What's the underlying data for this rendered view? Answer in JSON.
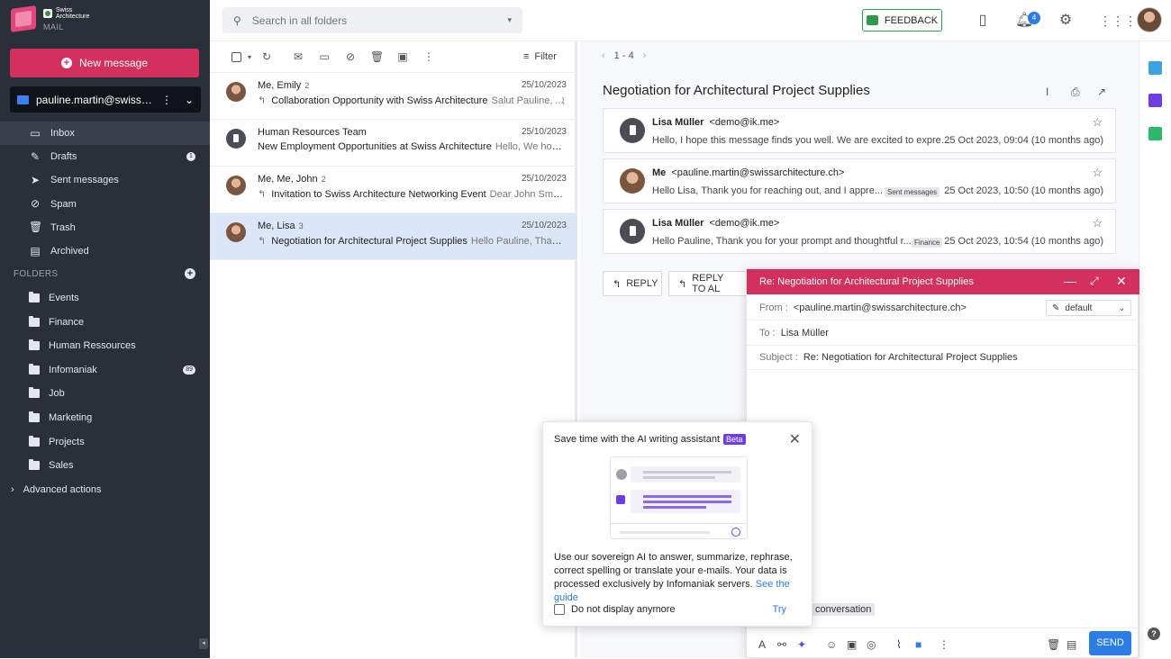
{
  "app": {
    "brand_line1": "Swiss",
    "brand_line2": "Architecture",
    "product": "MAIL"
  },
  "sidebar": {
    "new_message": "New message",
    "account": "pauline.martin@swissarchi...",
    "items": [
      {
        "label": "Inbox",
        "icon": "inbox-icon",
        "badge": ""
      },
      {
        "label": "Drafts",
        "icon": "drafts-icon",
        "badge": "1"
      },
      {
        "label": "Sent messages",
        "icon": "send-icon",
        "badge": ""
      },
      {
        "label": "Spam",
        "icon": "spam-icon",
        "badge": ""
      },
      {
        "label": "Trash",
        "icon": "trash-icon",
        "badge": ""
      },
      {
        "label": "Archived",
        "icon": "archive-icon",
        "badge": ""
      }
    ],
    "folders_title": "FOLDERS",
    "folders": [
      {
        "label": "Events",
        "badge": ""
      },
      {
        "label": "Finance",
        "badge": ""
      },
      {
        "label": "Human Ressources",
        "badge": ""
      },
      {
        "label": "Infomaniak",
        "badge": "89"
      },
      {
        "label": "Job",
        "badge": ""
      },
      {
        "label": "Marketing",
        "badge": ""
      },
      {
        "label": "Projects",
        "badge": ""
      },
      {
        "label": "Sales",
        "badge": ""
      }
    ],
    "advanced": "Advanced actions"
  },
  "topbar": {
    "search_placeholder": "Search in all folders",
    "feedback": "FEEDBACK",
    "notifications": "4"
  },
  "list": {
    "filter": "Filter",
    "rows": [
      {
        "from": "Me, Emily",
        "count": "2",
        "date": "25/10/2023",
        "subject": "Collaboration Opportunity with Swiss Architecture",
        "preview": "Salut Pauline, ...",
        "reply": true,
        "attach": true,
        "selected": false,
        "robot": false
      },
      {
        "from": "Human Resources Team",
        "count": "",
        "date": "25/10/2023",
        "subject": "New Employment Opportunities at Swiss Architecture",
        "preview": "Hello, We hope ...",
        "reply": false,
        "attach": false,
        "selected": false,
        "robot": true
      },
      {
        "from": "Me, Me, John",
        "count": "2",
        "date": "25/10/2023",
        "subject": "Invitation to Swiss Architecture Networking Event",
        "preview": "Dear John Smith,...",
        "reply": true,
        "attach": false,
        "selected": false,
        "robot": false
      },
      {
        "from": "Me, Lisa",
        "count": "3",
        "date": "25/10/2023",
        "subject": "Negotiation for Architectural Project Supplies",
        "preview": "Hello Pauline, Thank ...",
        "reply": true,
        "attach": false,
        "selected": true,
        "robot": false
      }
    ]
  },
  "reader": {
    "pager": "1 - 4",
    "title": "Negotiation for Architectural Project Supplies",
    "messages": [
      {
        "sender": "Lisa Müller",
        "email": "<demo@ik.me>",
        "preview": "Hello, I hope this message finds you well. We are excited to expre...",
        "tag": "",
        "date": "25 Oct 2023, 09:04 (10 months ago)",
        "robot": true
      },
      {
        "sender": "Me",
        "email": "<pauline.martin@swissarchitecture.ch>",
        "preview": "Hello Lisa, Thank you for reaching out, and I appre...",
        "tag": "Sent messages",
        "date": "25 Oct 2023, 10:50 (10 months ago)",
        "robot": false
      },
      {
        "sender": "Lisa Müller",
        "email": "<demo@ik.me>",
        "preview": "Hello Pauline, Thank you for your prompt and thoughtful r...",
        "tag": "Finance",
        "date": "25 Oct 2023, 10:54 (10 months ago)",
        "robot": true
      }
    ],
    "reply": "REPLY",
    "reply_all": "REPLY TO AL"
  },
  "compose": {
    "title": "Re: Negotiation for Architectural Project Supplies",
    "from_label": "From :",
    "from": "<pauline.martin@swissarchitecture.ch>",
    "signature": "default",
    "to_label": "To :",
    "to": "Lisa Müller",
    "subject_label": "Subject :",
    "subject": "Re: Negotiation for Architectural Project Supplies",
    "conversation_chip": "conversation",
    "send": "SEND"
  },
  "ai_popup": {
    "title": "Save time with the AI writing assistant",
    "beta": "Beta",
    "body": "Use our sovereign AI to answer, summarize, rephrase, correct spelling or translate your e-mails. Your data is processed exclusively by Infomaniak servers.",
    "guide_link": "See the guide",
    "dont_show": "Do not display anymore",
    "try": "Try"
  },
  "colors": {
    "accent": "#d4305d",
    "blue": "#2d7de6",
    "sidebar": "#2b2f3a",
    "ai": "#6d3fe0"
  }
}
